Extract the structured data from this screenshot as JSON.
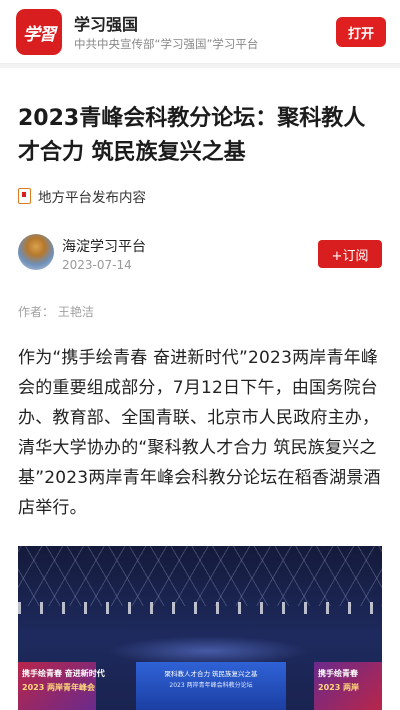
{
  "app_bar": {
    "logo_text": "学習",
    "app_name": "学习强国",
    "app_desc": "中共中央宣传部“学习强国”学习平台",
    "open_label": "打开"
  },
  "article": {
    "title": "2023青峰会科教分论坛：聚科教人才合力 筑民族复兴之基",
    "source_tag": "地方平台发布内容",
    "author_name": "海淀学习平台",
    "publish_date": "2023-07-14",
    "subscribe_label": "+订阅",
    "byline": "作者：  王艳洁",
    "paragraph": "作为“携手绘青春 奋进新时代”2023两岸青年峰会的重要组成部分，7月12日下午，由国务院台办、教育部、全国青联、北京市人民政府主办，清华大学协办的“聚科教人才合力 筑民族复兴之基”2023两岸青年峰会科教分论坛在稻香湖景酒店举行。"
  },
  "photo": {
    "left_screen_line1": "携手绘青春 奋进新时代",
    "left_screen_line2": "2023 两岸青年峰会",
    "center_screen_line1": "聚科教人才合力  筑民族复兴之基",
    "center_screen_line2": "2023 两岸青年峰会科教分论坛",
    "right_screen_line1": "携手绘青春",
    "right_screen_line2": "2023 两岸"
  },
  "colors": {
    "brand_red": "#d81e1e",
    "open_button": "#e02020"
  },
  "icons": {
    "source_tag_icon": "bookmark-icon"
  }
}
